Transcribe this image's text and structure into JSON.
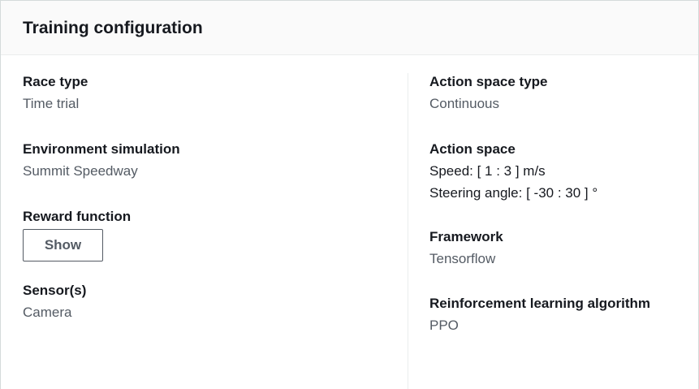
{
  "panel": {
    "title": "Training configuration"
  },
  "left_column": {
    "race_type": {
      "label": "Race type",
      "value": "Time trial"
    },
    "environment": {
      "label": "Environment simulation",
      "value": "Summit Speedway"
    },
    "reward_function": {
      "label": "Reward function",
      "button_label": "Show"
    },
    "sensors": {
      "label": "Sensor(s)",
      "value": "Camera"
    }
  },
  "right_column": {
    "action_space_type": {
      "label": "Action space type",
      "value": "Continuous"
    },
    "action_space": {
      "label": "Action space",
      "speed": "Speed: [ 1 : 3 ] m/s",
      "steering": "Steering angle: [ -30 : 30 ] °"
    },
    "framework": {
      "label": "Framework",
      "value": "Tensorflow"
    },
    "algorithm": {
      "label": "Reinforcement learning algorithm",
      "value": "PPO"
    }
  }
}
